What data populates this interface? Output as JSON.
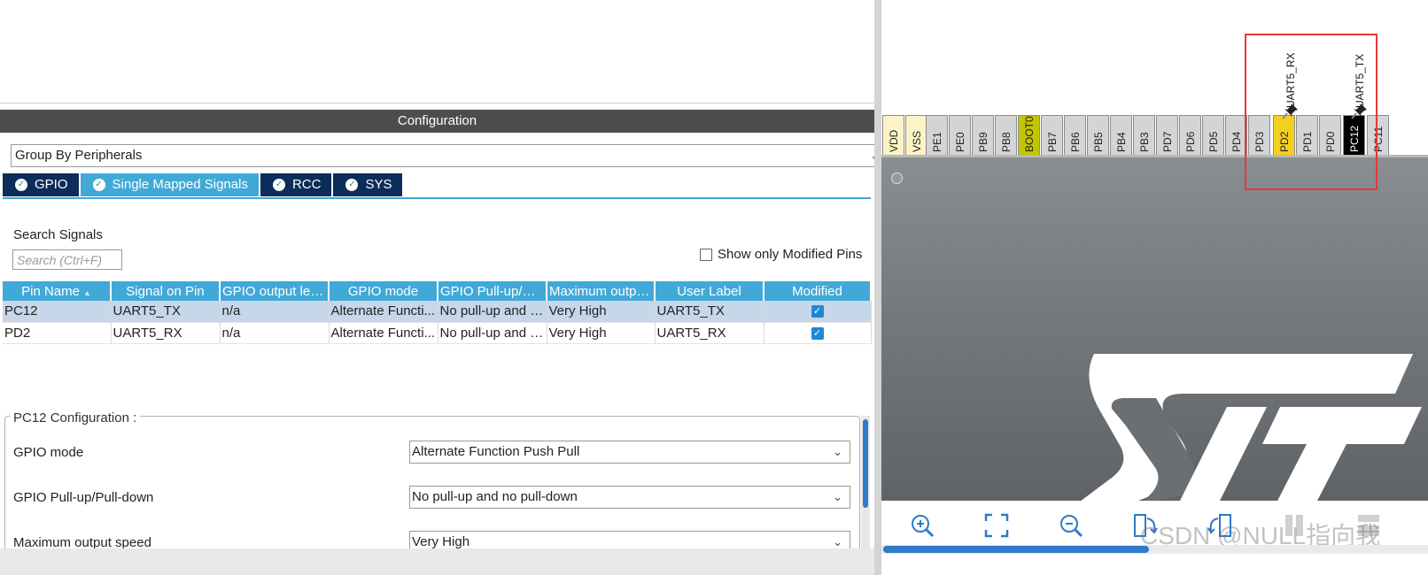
{
  "configuration": {
    "title": "Configuration",
    "group_by": "Group By Peripherals",
    "tabs": [
      {
        "label": "GPIO",
        "active": false
      },
      {
        "label": "Single Mapped Signals",
        "active": true
      },
      {
        "label": "RCC",
        "active": false
      },
      {
        "label": "SYS",
        "active": false
      }
    ],
    "search": {
      "label": "Search Signals",
      "placeholder": "Search (Ctrl+F)",
      "value": ""
    },
    "show_modified_label": "Show only Modified Pins",
    "show_modified_checked": false,
    "table": {
      "headers": [
        "Pin Name",
        "Signal on Pin",
        "GPIO output level",
        "GPIO mode",
        "GPIO Pull-up/Pu...",
        "Maximum output...",
        "User Label",
        "Modified"
      ],
      "rows": [
        {
          "pin": "PC12",
          "signal": "UART5_TX",
          "level": "n/a",
          "mode": "Alternate Functi...",
          "pull": "No pull-up and n...",
          "speed": "Very High",
          "label": "UART5_TX",
          "modified": true
        },
        {
          "pin": "PD2",
          "signal": "UART5_RX",
          "level": "n/a",
          "mode": "Alternate Functi...",
          "pull": "No pull-up and n...",
          "speed": "Very High",
          "label": "UART5_RX",
          "modified": true
        }
      ]
    },
    "pin_config": {
      "title": "PC12 Configuration :",
      "fields": [
        {
          "label": "GPIO mode",
          "value": "Alternate Function Push Pull"
        },
        {
          "label": "GPIO Pull-up/Pull-down",
          "value": "No pull-up and no pull-down"
        },
        {
          "label": "Maximum output speed",
          "value": "Very High"
        }
      ]
    }
  },
  "chip": {
    "pins": [
      "VDD",
      "VSS",
      "PE1",
      "PE0",
      "PB9",
      "PB8",
      "BOOT0",
      "PB7",
      "PB6",
      "PB5",
      "PB4",
      "PB3",
      "PD7",
      "PD6",
      "PD5",
      "PD4",
      "PD3",
      "PD2",
      "PD1",
      "PD0",
      "PC12",
      "PC11"
    ],
    "signal_labels": {
      "pd2": "UART5_RX",
      "pc12": "UART5_TX"
    },
    "colors": {
      "assigned_yellow": "#f2d01e",
      "assigned_black": "#000000",
      "boot": "#c2c600",
      "power": "#fdf4c6",
      "highlight": "#e53935",
      "accent": "#41a9d8"
    }
  },
  "toolbar": {
    "icons": [
      "zoom-in-icon",
      "fit-screen-icon",
      "zoom-out-icon",
      "rotate-icon",
      "rotate-back-icon",
      "split-icon",
      "layout-icon"
    ]
  },
  "watermark": "CSDN @NULL指向我"
}
